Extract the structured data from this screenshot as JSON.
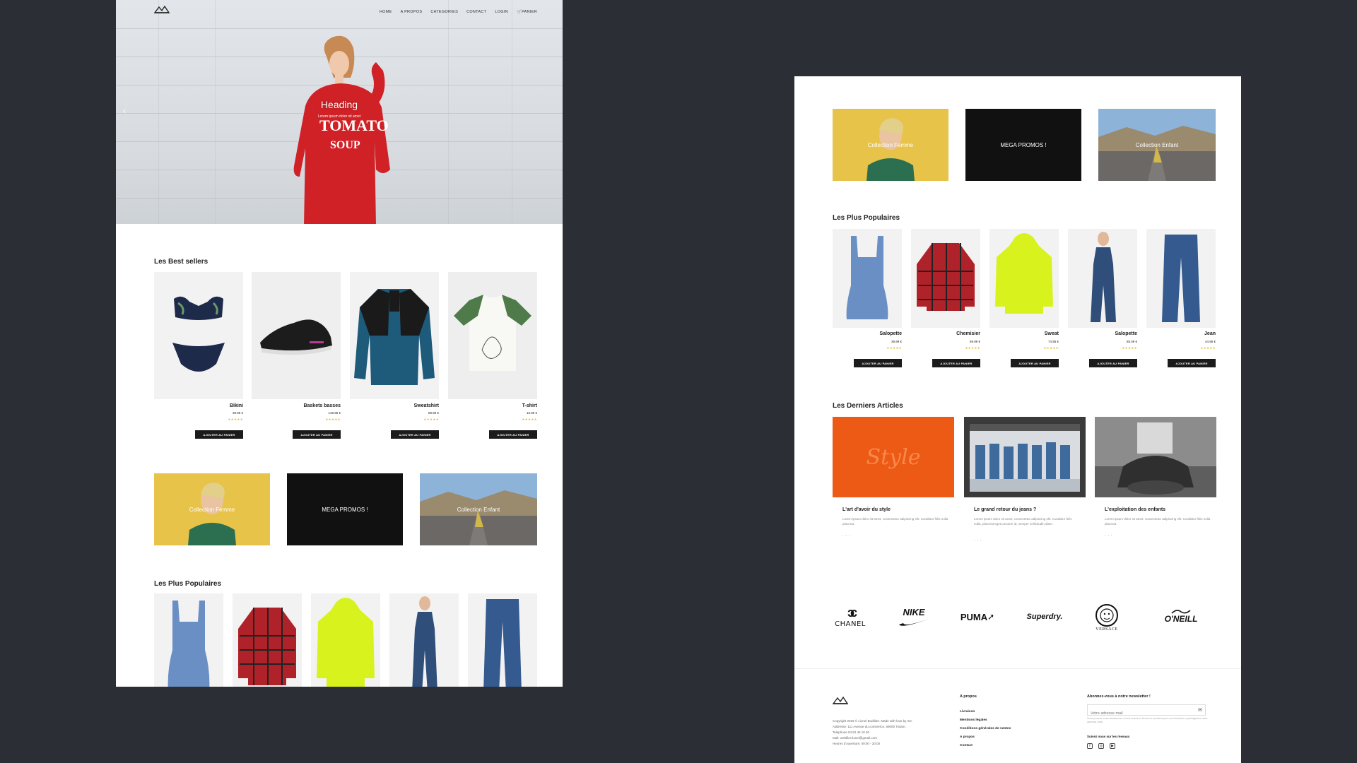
{
  "nav": {
    "items": [
      "HOME",
      "A PROPOS",
      "CATEGORIES",
      "CONTACT",
      "LOGIN"
    ],
    "cart": "PANIER"
  },
  "hero": {
    "heading": "Heading",
    "subheading": "Lorem ipsum dolor sit amet",
    "prev_arrow": "‹"
  },
  "best_sellers": {
    "title": "Les Best sellers",
    "products": [
      {
        "name": "Bikini",
        "price": "39.99 €",
        "stars": "★★★★★",
        "button": "AJOUTER AU PANIER"
      },
      {
        "name": "Baskets basses",
        "price": "149.95 €",
        "stars": "★★★★★",
        "button": "AJOUTER AU PANIER"
      },
      {
        "name": "Sweatshirt",
        "price": "89.90 €",
        "stars": "★★★★★",
        "button": "AJOUTER AU PANIER"
      },
      {
        "name": "T-shirt",
        "price": "15.95 €",
        "stars": "★★★★★",
        "button": "AJOUTER AU PANIER"
      }
    ]
  },
  "collections": [
    {
      "label": "Collection Femme"
    },
    {
      "label": "MEGA PROMOS !"
    },
    {
      "label": "Collection Enfant"
    }
  ],
  "popular": {
    "title": "Les Plus Populaires",
    "products": [
      {
        "name": "Salopette",
        "price": "39.99 €",
        "stars": "★★★★★",
        "button": "AJOUTER AU PANIER"
      },
      {
        "name": "Chemisier",
        "price": "69.99 €",
        "stars": "★★★★★",
        "button": "AJOUTER AU PANIER"
      },
      {
        "name": "Sweat",
        "price": "74.95 €",
        "stars": "★★★★★",
        "button": "AJOUTER AU PANIER"
      },
      {
        "name": "Salopette",
        "price": "85.09 €",
        "stars": "★★★★★",
        "button": "AJOUTER AU PANIER"
      },
      {
        "name": "Jean",
        "price": "44.95 €",
        "stars": "★★★★★",
        "button": "AJOUTER AU PANIER"
      }
    ]
  },
  "articles": {
    "title": "Les Derniers Articles",
    "items": [
      {
        "title": "L'art d'avoir du style",
        "text": "Lorem ipsum dolor sit amet, consectetur adipiscing elit. Curabitur felis nulla placerat.",
        "dots": "• • •",
        "image_word": "Style"
      },
      {
        "title": "Le grand retour du jeans ?",
        "text": "Lorem ipsum dolor sit amet, consectetur adipiscing elit. Curabitur felis nulla, placerat eget posuere id, semper sollicitudin diam.",
        "dots": "• • •"
      },
      {
        "title": "L'exploitation des enfants",
        "text": "Lorem ipsum dolor sit amet, consectetur adipiscing elit. Curabitur felis nulla placerat.",
        "dots": "• • •"
      }
    ]
  },
  "brands": [
    "CHANEL",
    "NIKE",
    "PUMA",
    "Superdry.",
    "VERSACE",
    "O'NEILL"
  ],
  "footer": {
    "address_lines": [
      "Copyright 2019 © Lionel Bodilder. Made with love by me.",
      "Addresse: 111 Avenue du commerce, 69000 Toulon.",
      "Telephone 04 52 45 10 60",
      "Mail: webfiler.lionel@gmail.com",
      "Heures d'ouverture: 09:00 - 20:00"
    ],
    "about_title": "A propos",
    "links": [
      "Livraison",
      "Mentions légales",
      "Conditions générales de ventes",
      "A propos",
      "Contact"
    ],
    "newsletter_title": "Abonnez-vous à notre newsletter !",
    "newsletter_placeholder": "Votre adresse mail",
    "newsletter_note": "Vous pouvez vous désinscrire à tout moment. Nous ne vendons pas vos données ni partageons votre adresse mail.",
    "social_title": "Suivez nous sur les réseaux",
    "social_icons": [
      "f",
      "◎",
      "▶"
    ]
  }
}
